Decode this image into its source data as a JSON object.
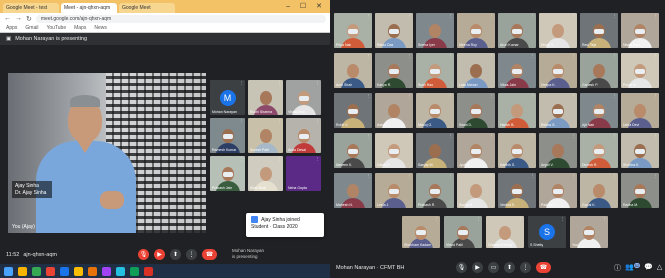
{
  "left": {
    "tabs": [
      "Google Meet - test",
      "Meet - ajn-qhxn-aqm",
      "Google Meet"
    ],
    "url": "meet.google.com/ajn-qhxn-aqm",
    "bookmarks": [
      "Apps",
      "Gmail",
      "YouTube",
      "Maps",
      "News"
    ],
    "presenting_label": "Mohan Narayan is presenting",
    "speaker_name": "Ajay Sinha",
    "speaker_role": "Dr. Ajay Sinha",
    "presenter_label": "You (Ajay)",
    "tiles": [
      {
        "name": "Mohan Narayan",
        "avatar": "M",
        "kind": "avatar"
      },
      {
        "name": "Ruchi Sharma",
        "kind": "person",
        "bg": "#c7c3b5",
        "shirt": "#8d4a6b"
      },
      {
        "name": "Vishal Rao",
        "kind": "person",
        "bg": "#9fa2a0",
        "shirt": "#e5e5e5"
      },
      {
        "name": "Ramesh Kumar",
        "kind": "person",
        "bg": "#7f8a8f",
        "shirt": "#2c3e64"
      },
      {
        "name": "Suresh Patil",
        "kind": "person",
        "bg": "#c8c0a8",
        "shirt": "#a7b9c8"
      },
      {
        "name": "Anita Desai",
        "kind": "person",
        "bg": "#b5b3ac",
        "shirt": "#c23b3b"
      },
      {
        "name": "Prakash Jain",
        "kind": "person",
        "bg": "#b7c0b7",
        "shirt": "#3a5d3f"
      },
      {
        "name": "Kiran Bhat",
        "kind": "person",
        "bg": "#d1ccc0",
        "shirt": "#e5dfd0"
      },
      {
        "name": "Neha Gupta",
        "kind": "purple"
      }
    ],
    "popup_title": "Ajay Sinha joined",
    "popup_sub": "Student · Class 2020",
    "time_label": "11:52",
    "meeting_code": "ajn-qhxn-aqm",
    "right_text_1": "Mohan Narayan",
    "right_text_2": "is presenting"
  },
  "right": {
    "tiles": [
      "Priya Nair",
      "Rahul Das",
      "Sneha Iyer",
      "Meena Roy",
      "Arun Kumar",
      "Divya S.",
      "Ravi Teja",
      "Nisha Paul",
      "Amit Shah",
      "Kavya R.",
      "Sunil Rao",
      "Lata Menon",
      "Vikas Jain",
      "Deepa K.",
      "Ganesh P.",
      "Pooja M.",
      "Rohit V.",
      "Asha T.",
      "Manoj G.",
      "Swati D.",
      "Harish B.",
      "Rekha S.",
      "Ajit Nair",
      "Usha Devi",
      "Naveen K.",
      "Geeta P.",
      "Sanjay M.",
      "Jyoti R.",
      "Karthik S.",
      "Anjali V.",
      "Dinesh R.",
      "Shobha K.",
      "Mahesh N.",
      "Leela J.",
      "Prakash R.",
      "Sunita B.",
      "Venkat S.",
      "Padma L.",
      "Gopal K.",
      "Radha M."
    ],
    "bottom_tiles": [
      "Shubham Kadam",
      "Vinod Patil",
      "Chandra Reddy",
      "S Shetty",
      "You"
    ],
    "bottom_avatar": {
      "index": 3,
      "letter": "S"
    },
    "meeting_name": "Mohan Narayan · CFMT BH",
    "people_count": "52"
  },
  "colors": {
    "meet_bg": "#202124",
    "end_call": "#ea4335",
    "accent_blue": "#1a73e8",
    "tab_strip": "#f3c267"
  }
}
